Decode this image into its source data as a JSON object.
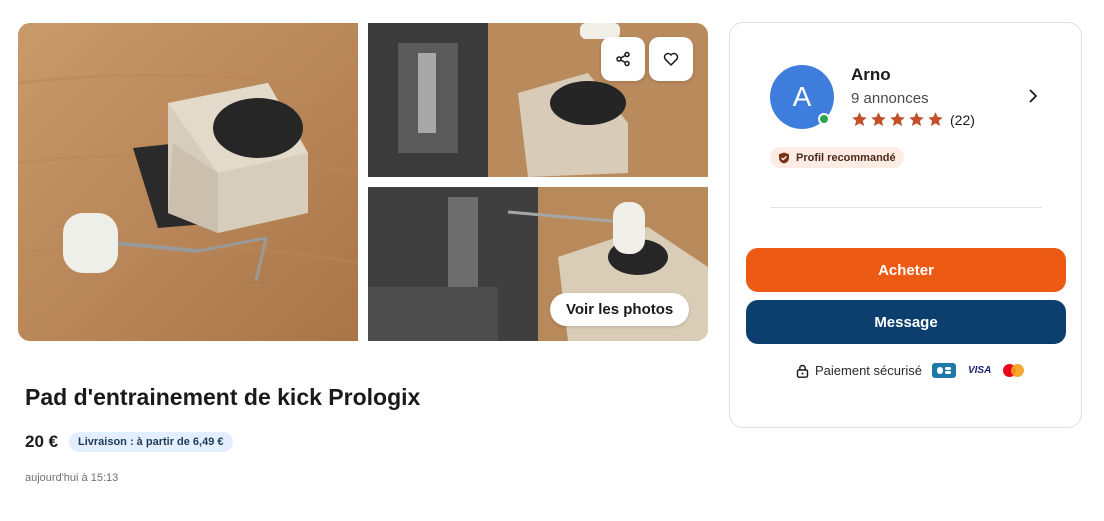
{
  "gallery": {
    "see_photos_label": "Voir les photos"
  },
  "listing": {
    "title": "Pad d'entrainement de kick Prologix",
    "price": "20 €",
    "shipping": "Livraison : à partir de 6,49 €",
    "date": "aujourd'hui à 15:13"
  },
  "seller": {
    "initial": "A",
    "name": "Arno",
    "ads_count": "9 annonces",
    "rating_stars": 5,
    "rating_count": "(22)",
    "badge": "Profil recommandé"
  },
  "actions": {
    "buy_label": "Acheter",
    "message_label": "Message"
  },
  "payment": {
    "label": "Paiement sécurisé",
    "visa": "VISA"
  },
  "colors": {
    "buy": "#ec5a13",
    "message": "#0c3f6e",
    "avatar": "#3e7ddb",
    "star": "#c2512b"
  },
  "icons": [
    "share-icon",
    "heart-icon",
    "chevron-right-icon",
    "star-icon",
    "shield-check-icon",
    "lock-icon",
    "cb-card-icon",
    "mastercard-icon"
  ]
}
